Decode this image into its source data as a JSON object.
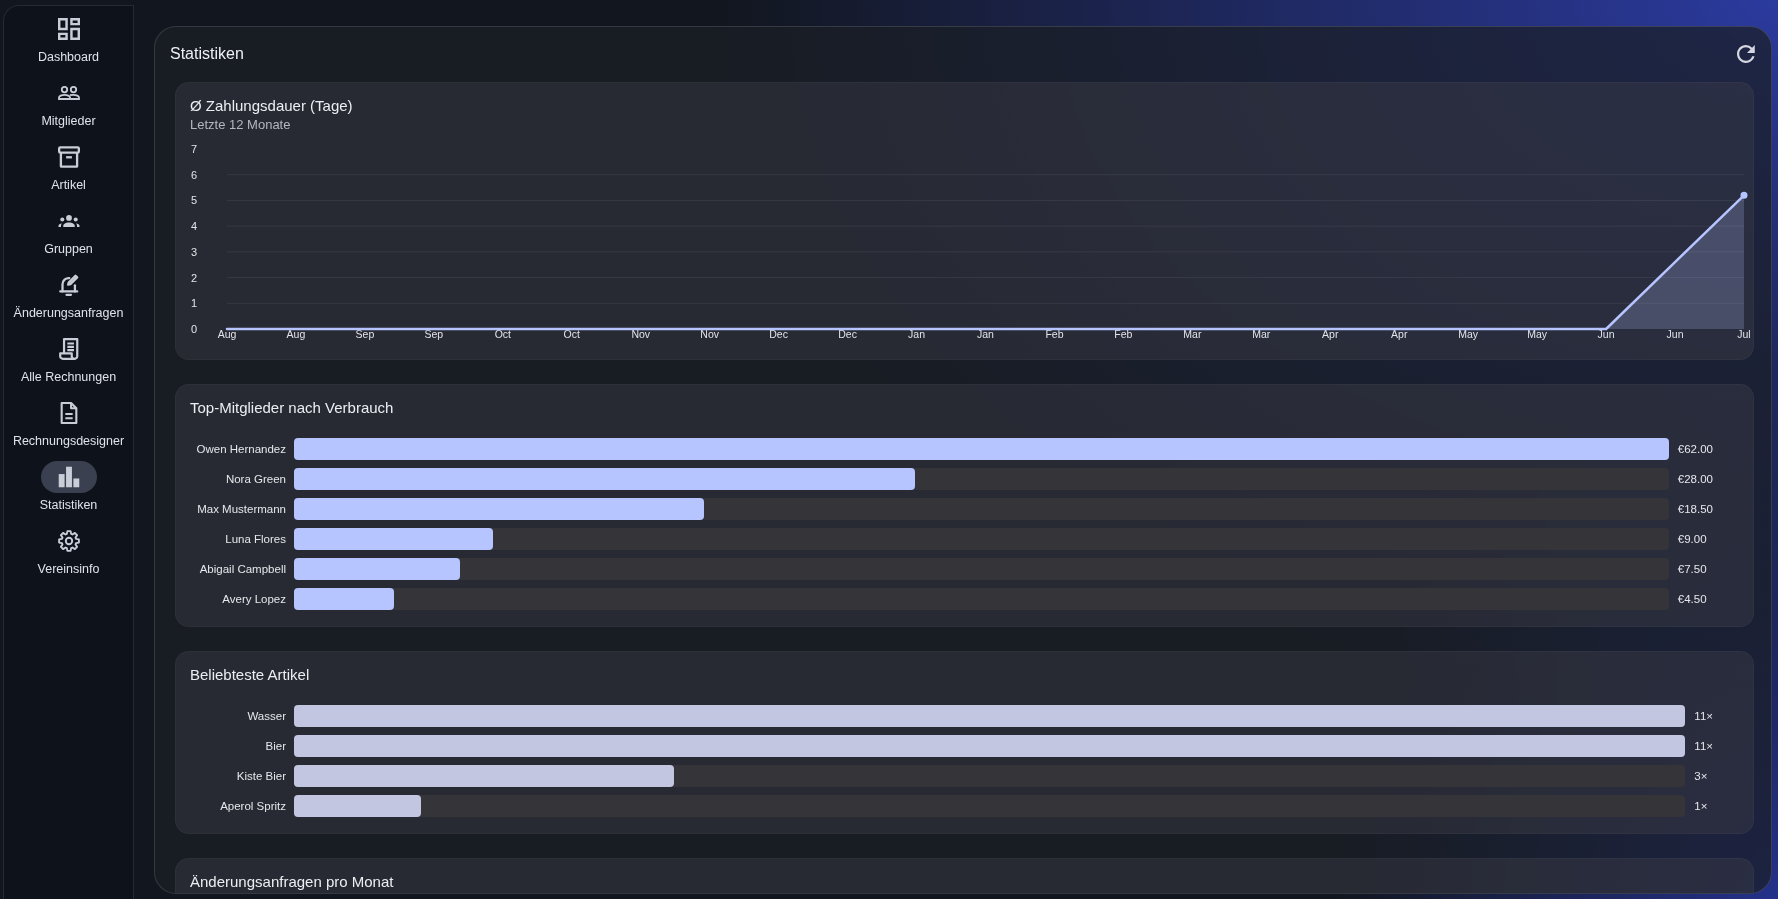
{
  "sidebar": {
    "items": [
      {
        "label": "Dashboard",
        "selected": false
      },
      {
        "label": "Mitglieder",
        "selected": false
      },
      {
        "label": "Artikel",
        "selected": false
      },
      {
        "label": "Gruppen",
        "selected": false
      },
      {
        "label": "Änderungsanfragen",
        "selected": false
      },
      {
        "label": "Alle Rechnungen",
        "selected": false
      },
      {
        "label": "Rechnungsdesigner",
        "selected": false
      },
      {
        "label": "Statistiken",
        "selected": true
      },
      {
        "label": "Vereinsinfo",
        "selected": false
      }
    ]
  },
  "page": {
    "title": "Statistiken"
  },
  "cards": [
    {
      "title": "Ø Zahlungsdauer (Tage)",
      "subtitle": "Letzte 12 Monate",
      "chart_data": {
        "type": "area",
        "categories": [
          "Aug",
          "Aug",
          "Sep",
          "Sep",
          "Oct",
          "Oct",
          "Nov",
          "Nov",
          "Dec",
          "Dec",
          "Jan",
          "Jan",
          "Feb",
          "Feb",
          "Mar",
          "Mar",
          "Apr",
          "Apr",
          "May",
          "May",
          "Jun",
          "Jun",
          "Jul"
        ],
        "series": [
          {
            "color": "#b6c4ff",
            "values": [
              0,
              0,
              0,
              0,
              0,
              0,
              0,
              0,
              0,
              0,
              0,
              0,
              0,
              0,
              0,
              0,
              0,
              0,
              0,
              0,
              0,
              2.6,
              5.2
            ]
          }
        ],
        "ylim": [
          0,
          7
        ],
        "yticks": [
          0,
          1,
          2,
          3,
          4,
          5,
          6,
          7
        ],
        "grid": true
      }
    },
    {
      "title": "Top-Mitglieder nach Verbrauch",
      "color": "#b6c4ff",
      "rows": [
        {
          "label": "Owen Hernandez",
          "level": 1,
          "reading": "€62.00"
        },
        {
          "label": "Nora Green",
          "level": 0.452,
          "reading": "€28.00"
        },
        {
          "label": "Max Mustermann",
          "level": 0.298,
          "reading": "€18.50"
        },
        {
          "label": "Luna Flores",
          "level": 0.145,
          "reading": "€9.00"
        },
        {
          "label": "Abigail Campbell",
          "level": 0.121,
          "reading": "€7.50"
        },
        {
          "label": "Avery Lopez",
          "level": 0.073,
          "reading": "€4.50"
        }
      ]
    },
    {
      "title": "Beliebteste Artikel",
      "color": "#c3c6e0",
      "rows": [
        {
          "label": "Wasser",
          "level": 1,
          "reading": "11×"
        },
        {
          "label": "Bier",
          "level": 1,
          "reading": "11×"
        },
        {
          "label": "Kiste Bier",
          "level": 0.273,
          "reading": "3×"
        },
        {
          "label": "Aperol Spritz",
          "level": 0.091,
          "reading": "1×"
        }
      ]
    },
    {
      "title": "Änderungsanfragen pro Monat"
    }
  ]
}
